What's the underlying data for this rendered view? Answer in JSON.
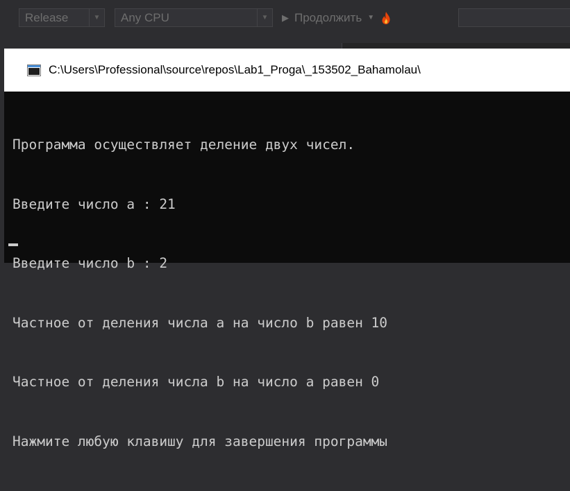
{
  "toolbar": {
    "configuration": "Release",
    "platform": "Any CPU",
    "continue_label": "Продолжить"
  },
  "console": {
    "title": "C:\\Users\\Professional\\source\\repos\\Lab1_Proga\\_153502_Bahamolau\\",
    "lines": [
      "Программа осуществляет деление двух чисел.",
      "Введите число a : 21",
      "Введите число b : 2",
      "Частное от деления числа a на число b равен 10",
      "Частное от деления числа b на число a равен 0",
      "Нажмите любую клавишу для завершения программы"
    ]
  },
  "colors": {
    "console_bg": "#0c0c0c",
    "console_text": "#cccccc",
    "toolbar_bg": "#2d2d30",
    "flame_accent": "#e8440a"
  }
}
